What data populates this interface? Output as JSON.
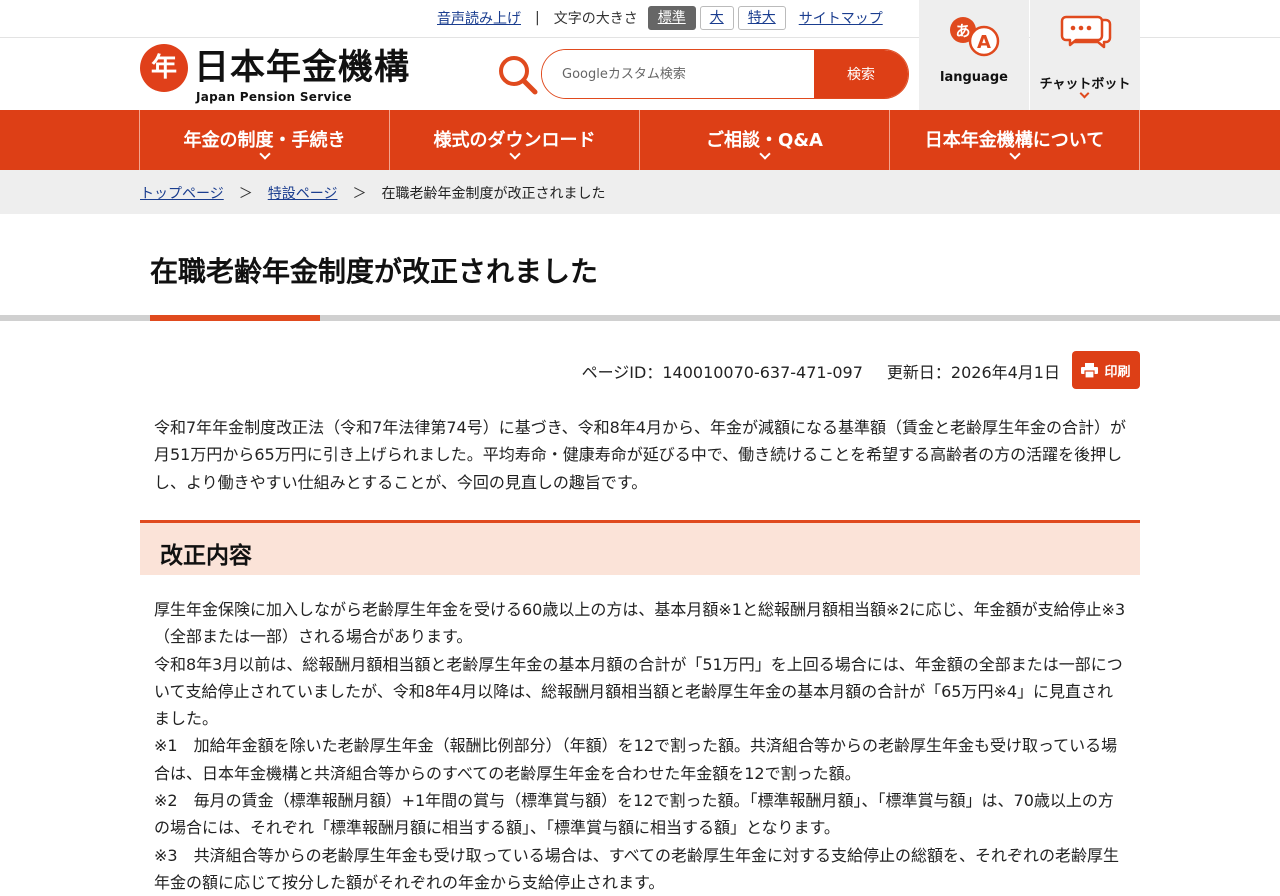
{
  "utility": {
    "audio_link": "音声読み上げ",
    "fontsize_label": "文字の大きさ",
    "fontsizes": [
      "標準",
      "大",
      "特大"
    ],
    "sitemap": "サイトマップ"
  },
  "header": {
    "logo_text": "日本年金機構",
    "logo_subtitle": "Japan Pension Service",
    "search_placeholder": "Googleカスタム検索",
    "search_button": "検索",
    "language_label": "language",
    "chatbot_label": "チャットボット"
  },
  "nav": {
    "items": [
      "年金の制度・手続き",
      "様式のダウンロード",
      "ご相談・Q&A",
      "日本年金機構について"
    ]
  },
  "breadcrumb": {
    "items": [
      "トップページ",
      "特設ページ"
    ],
    "separator": "＞",
    "current": "在職老齢年金制度が改正されました"
  },
  "page": {
    "title": "在職老齢年金制度が改正されました",
    "page_id": "ページID：140010070-637-471-097",
    "updated": "更新日：2026年4月1日",
    "print_label": "印刷",
    "intro": [
      "令和7年年金制度改正法（令和7年法律第74号）に基づき、令和8年4月から、年金が減額になる基準額（賃金と老齢厚生年金の合計）が月51万円から65万円に引き上げられました。平均寿命・健康寿命が延びる中で、働き続けることを希望する高齢者の方の活躍を後押しし、より働きやすい仕組みとすることが、今回の見直しの趣旨です。"
    ],
    "section_heading": "改正内容",
    "section_paragraphs": [
      "厚生年金保険に加入しながら老齢厚生年金を受ける60歳以上の方は、基本月額※1と総報酬月額相当額※2に応じ、年金額が支給停止※3（全部または一部）される場合があります。",
      "令和8年3月以前は、総報酬月額相当額と老齢厚生年金の基本月額の合計が「51万円」を上回る場合には、年金額の全部または一部について支給停止されていましたが、令和8年4月以降は、総報酬月額相当額と老齢厚生年金の基本月額の合計が「65万円※4」に見直されました。",
      "※1　加給年金額を除いた老齢厚生年金（報酬比例部分）（年額）を12で割った額。共済組合等からの老齢厚生年金も受け取っている場合は、日本年金機構と共済組合等からのすべての老齢厚生年金を合わせた年金額を12で割った額。",
      "※2　毎月の賃金（標準報酬月額）+1年間の賞与（標準賞与額）を12で割った額。「標準報酬月額」、「標準賞与額」は、70歳以上の方の場合には、それぞれ「標準報酬月額に相当する額」、「標準賞与額に相当する額」となります。",
      "※3　共済組合等からの老齢厚生年金も受け取っている場合は、すべての老齢厚生年金に対する支給停止の総額を、それぞれの老齢厚生年金の額に応じて按分した額がそれぞれの年金から支給停止されます。"
    ]
  },
  "colors": {
    "brand_orange": "#dd3f16",
    "section_bg": "#fbe3d8",
    "link_blue": "#1a3d8f"
  }
}
